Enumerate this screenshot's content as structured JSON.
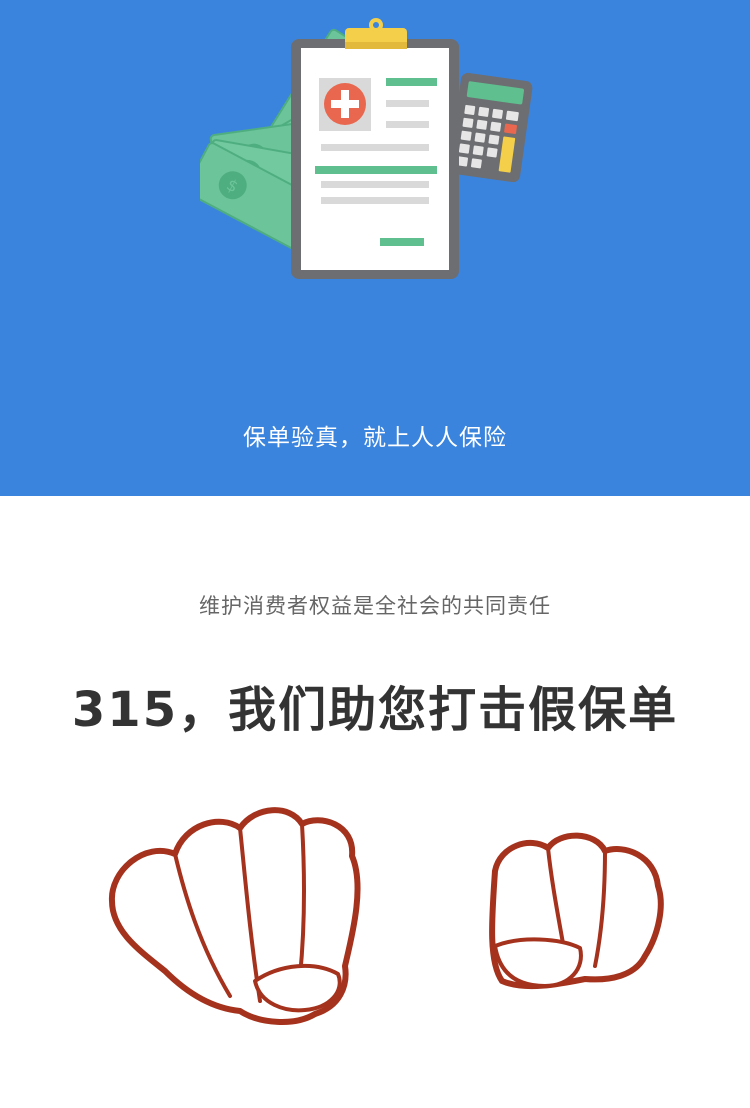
{
  "hero": {
    "background_color": "#3a84de",
    "illustration_icon": "insurance-policy-clipboard-with-money-and-calculator",
    "slogan": "保单验真，就上人人保险"
  },
  "content": {
    "subtitle": "维护消费者权益是全社会的共同责任",
    "headline": "315，我们助您打击假保单",
    "illustration_icon": "two-raised-fists"
  },
  "colors": {
    "accent_blue": "#3a84de",
    "fist_outline": "#a4321d",
    "cross_red": "#e8674e",
    "money_green": "#6cc59a"
  }
}
